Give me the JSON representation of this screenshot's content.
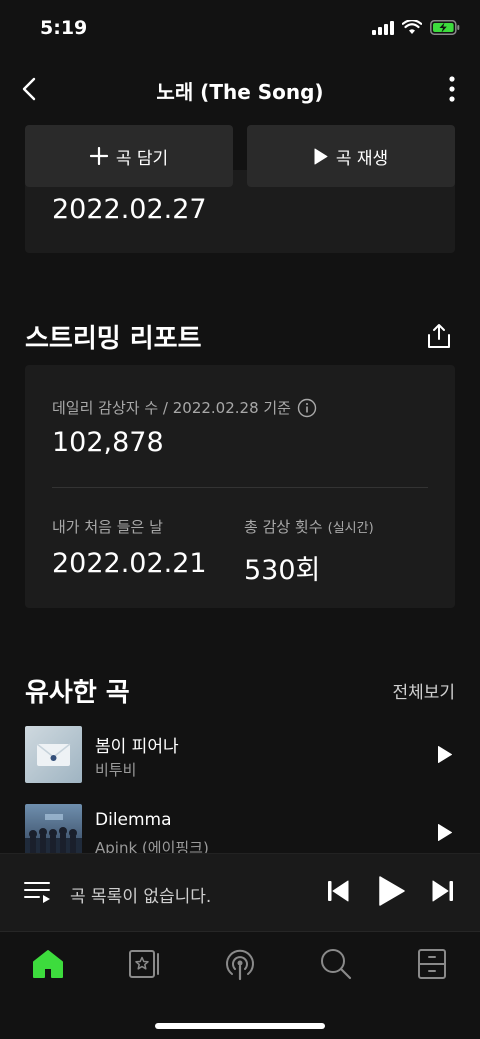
{
  "status": {
    "time": "5:19"
  },
  "header": {
    "title": "노래 (The Song)"
  },
  "actions": {
    "add_label": "곡 담기",
    "play_label": "곡 재생"
  },
  "prev_card": {
    "date": "2022.02.27"
  },
  "streaming_report": {
    "title": "스트리밍 리포트",
    "daily_label": "데일리 감상자 수 / 2022.02.28 기준",
    "daily_value": "102,878",
    "first_listen_label": "내가 처음 들은 날",
    "first_listen_value": "2022.02.21",
    "total_plays_label": "총 감상 횟수",
    "total_plays_suffix": "(실시간)",
    "total_plays_value": "530회"
  },
  "similar": {
    "title": "유사한 곡",
    "see_all": "전체보기",
    "songs": [
      {
        "title": "봄이 피어나",
        "artist": "비투비"
      },
      {
        "title": "Dilemma",
        "artist": "Apink (에이핑크)"
      }
    ]
  },
  "player": {
    "message": "곡 목록이 없습니다."
  },
  "colors": {
    "accent": "#3ddc3d",
    "background": "#121212",
    "card": "#1c1c1c"
  },
  "tabs": [
    "home-icon",
    "library-icon",
    "podcast-icon",
    "search-icon",
    "storage-icon"
  ]
}
